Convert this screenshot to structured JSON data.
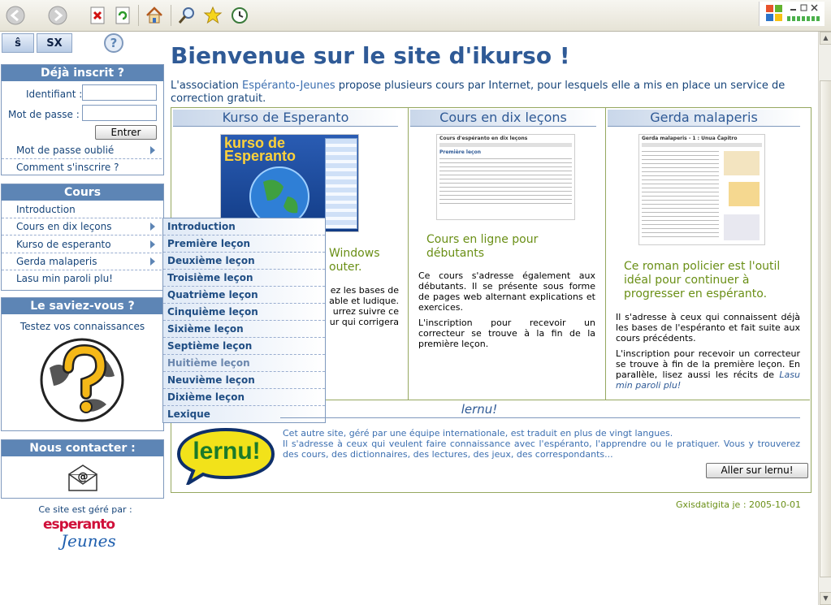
{
  "languages": {
    "eo": "ŝ",
    "sx": "SX"
  },
  "login": {
    "title": "Déjà inscrit ?",
    "id_label": "Identifiant :",
    "password_label": "Mot de passe :",
    "submit_label": "Entrer",
    "forgot_label": "Mot de passe oublié",
    "register_label": "Comment s'inscrire ?"
  },
  "cours": {
    "title": "Cours",
    "items": [
      "Introduction",
      "Cours en dix leçons",
      "Kurso de esperanto",
      "Gerda malaperis",
      "Lasu min paroli plu!"
    ]
  },
  "submenu": {
    "items": [
      "Introduction",
      "Première leçon",
      "Deuxième leçon",
      "Troisième leçon",
      "Quatrième leçon",
      "Cinquième leçon",
      "Sixième leçon",
      "Septième leçon",
      "Huitième leçon",
      "Neuvième leçon",
      "Dixième leçon",
      "Lexique"
    ]
  },
  "saviez": {
    "title": "Le saviez-vous ?",
    "link": "Testez vos connaissances"
  },
  "contact": {
    "title": "Nous contacter :"
  },
  "footer_left": {
    "managed_by": "Ce site est géré par :",
    "logo_line1": "esperanto",
    "logo_line2": "Jeunes"
  },
  "main": {
    "title": "Bienvenue sur le site d'ikurso !",
    "intro_before": "L'association ",
    "intro_link": "Espéranto-Jeunes",
    "intro_after": " propose plusieurs cours par Internet, pour lesquels elle a mis en place un service de correction gratuit."
  },
  "col1": {
    "title": "Kurso de Esperanto",
    "thumb_title": "kurso de Esperanto",
    "green_partial": "Windows\nouter.",
    "body1_partial": "ez les bases de\nable et ludique.\nurrez suivre ce\nur qui corrigera"
  },
  "col2": {
    "title": "Cours en dix leçons",
    "thumb_title": "Cours d'espéranto en dix leçons",
    "thumb_heading": "Première leçon",
    "green": "Cours en ligne pour débutants",
    "body1": "Ce cours s'adresse également aux débutants. Il se présente sous forme de pages web alternant explications et exercices.",
    "body2": "L'inscription pour recevoir un correcteur se trouve à la fin de la première leçon."
  },
  "col3": {
    "title": "Gerda malaperis",
    "thumb_title": "Gerda malaperis - 1 : Unua Ĉapitro",
    "green": "Ce roman policier est l'outil idéal pour continuer à progresser en espéranto.",
    "body1": "Il s'adresse à ceux qui connaissent déjà les bases de l'espéranto et fait suite aux cours précédents.",
    "body2_before": "L'inscription pour recevoir un correcteur se trouve à fin de la première leçon. En parallèle, lisez aussi les récits de ",
    "body2_link": "Lasu min paroli plu!"
  },
  "lernu": {
    "title": "lernu!",
    "logo": "lernu!",
    "text1": "Cet autre site, géré par une équipe internationale, est traduit en plus de vingt langues.",
    "text2": "Il s'adresse à ceux qui veulent faire connaissance avec l'espéranto, l'apprendre ou le pratiquer. Vous y trouverez des cours, des dictionnaires, des lectures, des jeux, des correspondants...",
    "button": "Aller sur lernu!"
  },
  "date": "Gxisdatigita je : 2005-10-01",
  "colors": {
    "accent": "#5d85b5",
    "title": "#2f5a96",
    "green": "#6a8f16"
  }
}
